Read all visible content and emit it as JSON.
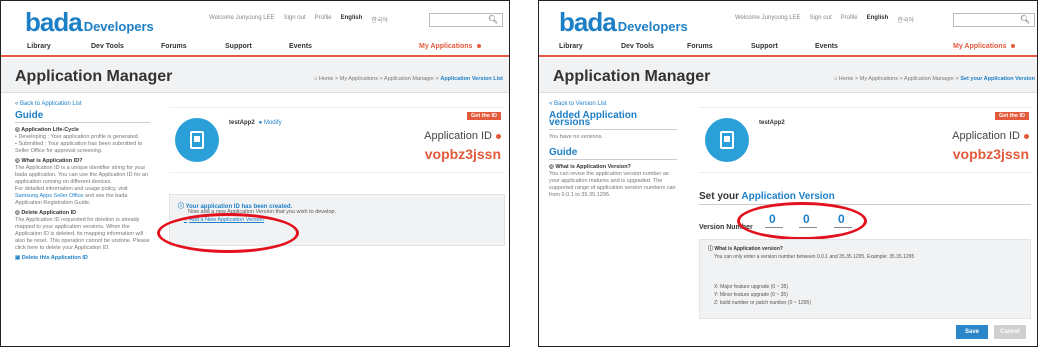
{
  "brand": {
    "logo_main": "bada",
    "logo_sub": "Developers"
  },
  "util": {
    "welcome": "Welcome Junyoung LEE",
    "signout": "Sign out",
    "profile": "Profile",
    "english": "English",
    "korean": "한국어"
  },
  "nav": {
    "library": "Library",
    "devtools": "Dev Tools",
    "forums": "Forums",
    "support": "Support",
    "events": "Events",
    "myapps": "My Applications"
  },
  "page_title": "Application Manager",
  "icons": {
    "search": "search-icon",
    "home": "home-icon",
    "app": "phone-app-icon",
    "info": "info-icon",
    "trash": "trash-icon"
  },
  "colors": {
    "brand_blue": "#1d7fc6",
    "accent_red": "#e35b3c",
    "highlight_ellipse": "#e3101d"
  },
  "left": {
    "breadcrumb_prefix": "Home > My Applications > Application Manager > ",
    "breadcrumb_current": "Application Version List",
    "back_link": "« Back to Application List",
    "guide_heading": "Guide",
    "lifecycle_title": "◎ Application Life-Cycle",
    "lifecycle_dev": "• Developing : Your application profile is generated.",
    "lifecycle_sub": "• Submitted : Your application has been submitted to Seller Office for approval screening.",
    "appid_q": "◎ What is Application ID?",
    "appid_text": "The Application ID is a unique identifier string for your bada application. You can use the Application ID for an application running on different devices.",
    "policy_text_a": "For detailed information and usage policy, visit ",
    "policy_link": "Samsung Apps Seller Office",
    "policy_text_b": " and see the bada Application Registration Guide.",
    "delete_title": "◎ Delete Application ID",
    "delete_text": "The Application ID requested for deletion is already mapped to your application versions. When the Application ID is deleted, its mapping information will also be reset. This operation cannot be undone. Please click here to delete your Application ID.",
    "delete_link": "Delete this Application ID",
    "app_name": "testApp2",
    "modify": "Modify",
    "get_id": "Get the ID",
    "appid_label": "Application ID",
    "appid_value": "vopbz3jssn",
    "created_title": "Your application ID has been created.",
    "created_desc": "Now add a new Application Version that you wish to develop.",
    "add_version": "Add a New Application Version"
  },
  "right": {
    "breadcrumb_prefix": "Home > My Applications > Application Manager > ",
    "breadcrumb_current": "Set your Application Version",
    "back_link": "« Back to Version List",
    "added_heading": "Added Application versions",
    "no_versions": "You have no versions.",
    "guide_heading": "Guide",
    "version_q": "◎ What is Application Version?",
    "version_text": "You can revise the application version number as your application matures and is upgraded. The supported range of application version numbers can from 0.0.1 to 35.35.1295.",
    "app_name": "testApp2",
    "get_id": "Get the ID",
    "appid_label": "Application ID",
    "appid_value": "vopbz3jssn",
    "setver_prefix": "Set your ",
    "setver_accent": "Application Version",
    "version_label": "Version Number",
    "version_major": "0",
    "version_minor": "0",
    "version_build": "0",
    "info_q": "What is Application version?",
    "info_a": "You can only enter a version number between 0.0.1 and 35.35.1295. Example: 35.35.1295",
    "info_x": "X: Major feature upgrade (0 ~ 35)",
    "info_y": "Y: Minor feature upgrade (0 ~ 35)",
    "info_z": "Z: build number or patch number (0 ~ 1295)",
    "save": "Save",
    "cancel": "Cancel"
  }
}
